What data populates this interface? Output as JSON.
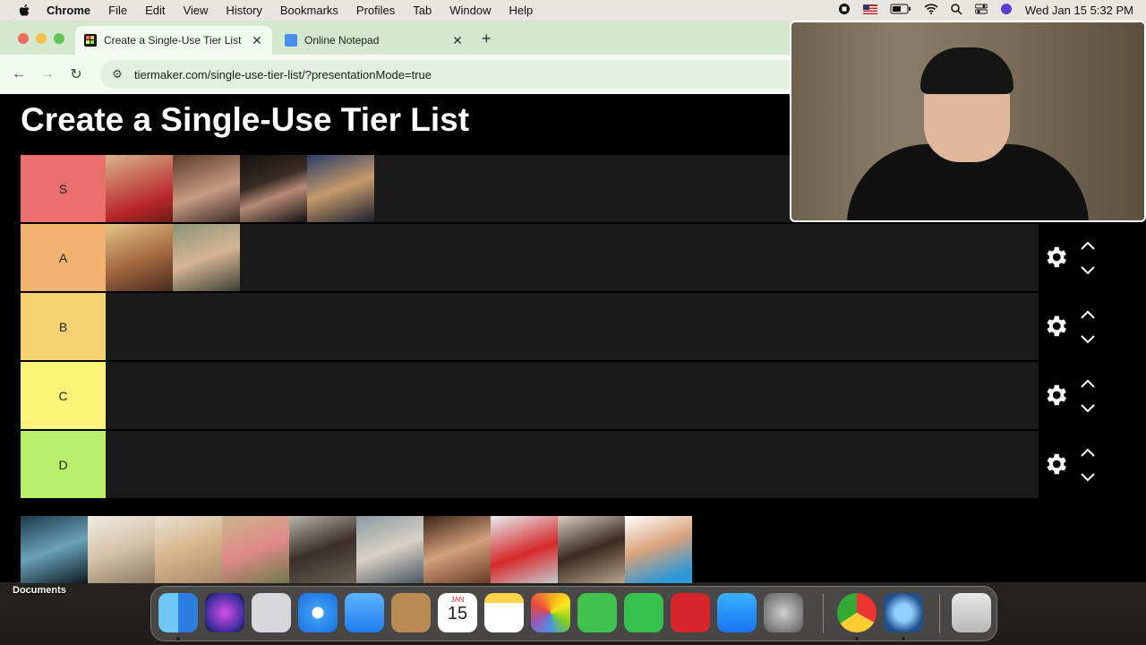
{
  "menubar": {
    "app": "Chrome",
    "items": [
      "File",
      "Edit",
      "View",
      "History",
      "Bookmarks",
      "Profiles",
      "Tab",
      "Window",
      "Help"
    ],
    "clock": "Wed Jan 15  5:32 PM"
  },
  "tabs": [
    {
      "title": "Create a Single-Use Tier List",
      "active": true
    },
    {
      "title": "Online Notepad",
      "active": false
    }
  ],
  "address": {
    "url": "tiermaker.com/single-use-tier-list/?presentationMode=true"
  },
  "page": {
    "title": "Create a Single-Use Tier List",
    "tiers": [
      {
        "label": "S",
        "color": "#ea6f6f",
        "image_count": 4
      },
      {
        "label": "A",
        "color": "#f0b26e",
        "image_count": 2
      },
      {
        "label": "B",
        "color": "#f7d274",
        "image_count": 0
      },
      {
        "label": "C",
        "color": "#fdf47a",
        "image_count": 0
      },
      {
        "label": "D",
        "color": "#b9ef6a",
        "image_count": 0
      }
    ],
    "unranked_image_count": 10
  },
  "desktop": {
    "folder_label": "Documents"
  },
  "dock": {
    "calendar_month": "JAN",
    "calendar_day": "15",
    "apps": [
      "finder-icon",
      "siri-icon",
      "launchpad-icon",
      "safari-icon",
      "mail-icon",
      "contacts-icon",
      "calendar-icon",
      "notes-icon",
      "photos-icon",
      "messages-icon",
      "facetime-icon",
      "photo-booth-icon",
      "app-store-icon",
      "system-settings-icon",
      "chrome-icon",
      "quicktime-icon",
      "trash-icon"
    ]
  }
}
